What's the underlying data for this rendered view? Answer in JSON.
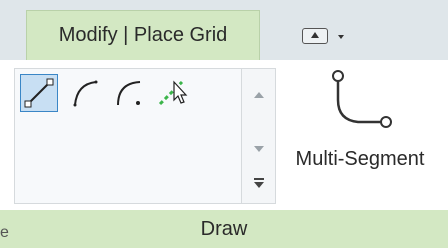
{
  "ribbon": {
    "active_tab": "Modify | Place Grid",
    "quick_access_icon": "panel-toggle-icon"
  },
  "draw_panel": {
    "tools": [
      {
        "name": "line-icon",
        "selected": true
      },
      {
        "name": "arc-icon",
        "selected": false
      },
      {
        "name": "arc-center-icon",
        "selected": false
      },
      {
        "name": "pick-lines-icon",
        "selected": false
      }
    ],
    "multi_segment_label": "Multi-Segment",
    "footer_label": "Draw"
  },
  "edge_text": "e",
  "colors": {
    "tab_green": "#d3e8c3",
    "selection_blue": "#3a86c6",
    "pick_green": "#3bb54a"
  }
}
